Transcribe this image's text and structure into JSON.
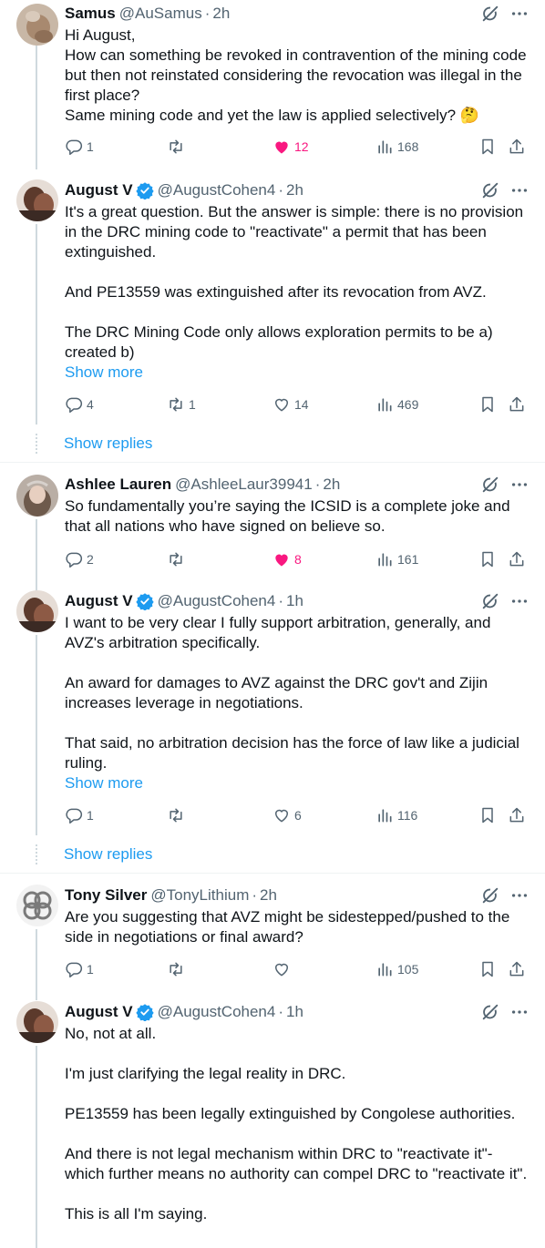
{
  "tweets": [
    {
      "name": "Samus",
      "handle": "@AuSamus",
      "time": "2h",
      "verified": false,
      "lines": [
        "Hi August,",
        "How can something be revoked in contravention of the mining code but then not reinstated considering the revocation was illegal in the first place?",
        "Same mining code and yet the law is applied selectively? 🤔"
      ],
      "replies": "1",
      "reposts": "",
      "likes": "12",
      "liked": true,
      "views": "168"
    },
    {
      "name": "August V",
      "handle": "@AugustCohen4",
      "time": "2h",
      "verified": true,
      "paras": [
        "It's a great question. But the answer is simple: there is no provision in the DRC mining code to \"reactivate\" a permit that has been extinguished.",
        "And PE13559 was extinguished after its revocation from AVZ.",
        "The DRC Mining Code only allows exploration permits to be a) created b)"
      ],
      "show_more": "Show more",
      "replies": "4",
      "reposts": "1",
      "likes": "14",
      "liked": false,
      "views": "469"
    },
    {
      "name": "Ashlee Lauren",
      "handle": "@AshleeLaur39941",
      "time": "2h",
      "verified": false,
      "paras": [
        "So fundamentally you’re saying the ICSID is a complete joke and that all nations who have signed on believe so."
      ],
      "replies": "2",
      "reposts": "",
      "likes": "8",
      "liked": true,
      "views": "161"
    },
    {
      "name": "August V",
      "handle": "@AugustCohen4",
      "time": "1h",
      "verified": true,
      "paras": [
        "I want to be very clear I fully support arbitration, generally, and AVZ's arbitration specifically.",
        "An award for damages to AVZ against the DRC gov't and Zijin increases leverage in negotiations.",
        "That said, no arbitration decision has the force of law like a judicial ruling."
      ],
      "show_more": "Show more",
      "replies": "1",
      "reposts": "",
      "likes": "6",
      "liked": false,
      "views": "116"
    },
    {
      "name": "Tony Silver",
      "handle": "@TonyLithium",
      "time": "2h",
      "verified": false,
      "paras": [
        "Are you suggesting that AVZ might be sidestepped/pushed to the side in negotiations or final award?"
      ],
      "replies": "1",
      "reposts": "",
      "likes": "",
      "liked": false,
      "views": "105"
    },
    {
      "name": "August V",
      "handle": "@AugustCohen4",
      "time": "1h",
      "verified": true,
      "paras": [
        "No, not at all.",
        "I'm just clarifying the legal reality in DRC.",
        "PE13559 has been legally extinguished by Congolese authorities.",
        "And there is not legal mechanism within DRC to \"reactivate it\"- which further means no authority can compel DRC to \"reactivate it\".",
        "This is all I'm saying."
      ]
    }
  ],
  "show_replies": "Show replies",
  "colors": {
    "accent": "#1d9bf0",
    "like": "#f91880",
    "muted": "#536471",
    "verified": "#1d9bf0"
  },
  "icons": [
    "reply-icon",
    "repost-icon",
    "like-icon",
    "views-icon",
    "bookmark-icon",
    "share-icon",
    "grok-icon",
    "more-icon",
    "verified-badge-icon"
  ]
}
